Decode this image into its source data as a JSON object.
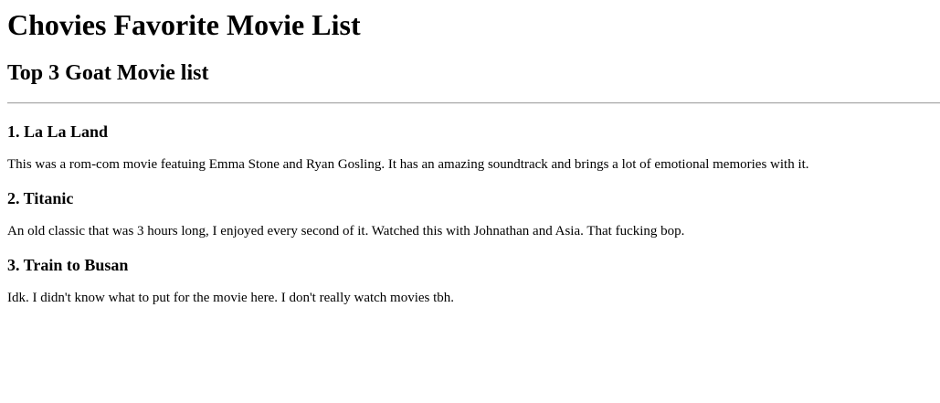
{
  "page": {
    "title": "Chovies Favorite Movie List",
    "subtitle": "Top 3 Goat Movie list"
  },
  "movies": [
    {
      "heading": "1. La La Land",
      "description": "This was a rom-com movie featuing Emma Stone and Ryan Gosling. It has an amazing soundtrack and brings a lot of emotional memories with it."
    },
    {
      "heading": "2. Titanic",
      "description": "An old classic that was 3 hours long, I enjoyed every second of it. Watched this with Johnathan and Asia. That fucking bop."
    },
    {
      "heading": "3. Train to Busan",
      "description": "Idk. I didn't know what to put for the movie here. I don't really watch movies tbh."
    }
  ]
}
